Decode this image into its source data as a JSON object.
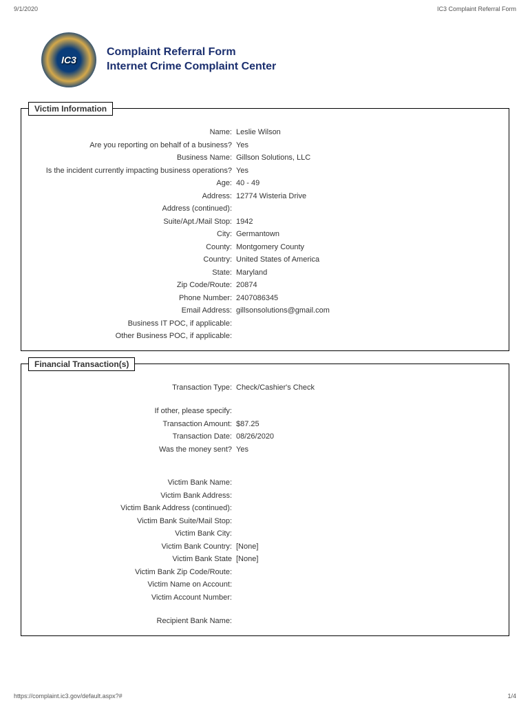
{
  "header": {
    "date": "9/1/2020",
    "doc_title": "IC3 Complaint Referral Form"
  },
  "title": {
    "line1": "Complaint Referral Form",
    "line2": "Internet Crime Complaint Center"
  },
  "sections": {
    "victim": {
      "heading": "Victim Information",
      "fields": [
        {
          "label": "Name:",
          "value": "Leslie Wilson"
        },
        {
          "label": "Are you reporting on behalf of a business?",
          "value": "Yes"
        },
        {
          "label": "Business Name:",
          "value": "Gillson Solutions, LLC"
        },
        {
          "label": "Is the incident currently impacting business operations?",
          "value": "Yes"
        },
        {
          "label": "Age:",
          "value": "40 - 49"
        },
        {
          "label": "Address:",
          "value": "12774 Wisteria Drive"
        },
        {
          "label": "Address (continued):",
          "value": ""
        },
        {
          "label": "Suite/Apt./Mail Stop:",
          "value": "1942"
        },
        {
          "label": "City:",
          "value": "Germantown"
        },
        {
          "label": "County:",
          "value": "Montgomery County"
        },
        {
          "label": "Country:",
          "value": "United States of America"
        },
        {
          "label": "State:",
          "value": "Maryland"
        },
        {
          "label": "Zip Code/Route:",
          "value": "20874"
        },
        {
          "label": "Phone Number:",
          "value": "2407086345"
        },
        {
          "label": "Email Address:",
          "value": "gillsonsolutions@gmail.com"
        },
        {
          "label": "Business IT POC, if applicable:",
          "value": ""
        },
        {
          "label": "Other Business POC, if applicable:",
          "value": ""
        }
      ]
    },
    "financial": {
      "heading": "Financial Transaction(s)",
      "groups": [
        [
          {
            "label": "Transaction Type:",
            "value": "Check/Cashier's Check"
          }
        ],
        [
          {
            "label": "If other, please specify:",
            "value": ""
          },
          {
            "label": "Transaction Amount:",
            "value": "$87.25"
          },
          {
            "label": "Transaction Date:",
            "value": "08/26/2020"
          },
          {
            "label": "Was the money sent?",
            "value": "Yes"
          }
        ],
        [
          {
            "label": "Victim Bank Name:",
            "value": ""
          },
          {
            "label": "Victim Bank Address:",
            "value": ""
          },
          {
            "label": "Victim Bank Address (continued):",
            "value": ""
          },
          {
            "label": "Victim Bank Suite/Mail Stop:",
            "value": ""
          },
          {
            "label": "Victim Bank City:",
            "value": ""
          },
          {
            "label": "Victim Bank Country:",
            "value": "[None]"
          },
          {
            "label": "Victim Bank State",
            "value": "[None]"
          },
          {
            "label": "Victim Bank Zip Code/Route:",
            "value": ""
          },
          {
            "label": "Victim Name on Account:",
            "value": ""
          },
          {
            "label": "Victim Account Number:",
            "value": ""
          }
        ],
        [
          {
            "label": "Recipient Bank Name:",
            "value": ""
          }
        ]
      ]
    }
  },
  "footer": {
    "url": "https://complaint.ic3.gov/default.aspx?#",
    "page": "1/4"
  }
}
